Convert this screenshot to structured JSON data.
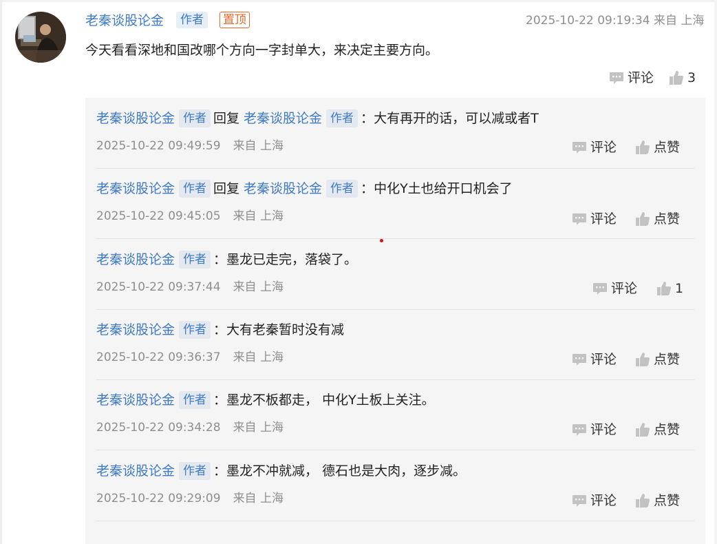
{
  "post": {
    "author": "老秦谈股论金",
    "author_badge": "作者",
    "pin_badge": "置顶",
    "timestamp": "2025-10-22 09:19:34",
    "location": "来自 上海",
    "content": "今天看看深地和国改哪个方向一字封单大，来决定主要方向。",
    "comment_label": "评论",
    "like_count": "3"
  },
  "icons": {
    "avatar": "user-avatar-photo",
    "comment": "speech-bubble-icon",
    "like": "thumbs-up-icon"
  },
  "colors": {
    "link_blue": "#3e7ac7",
    "badge_bg": "#e6eef8",
    "pin_orange": "#e06a2a",
    "meta_gray": "#8e8e8e",
    "reply_bg": "#f5f5f5",
    "icon_gray": "#c2c2c2"
  },
  "replies": [
    {
      "author": "老秦谈股论金",
      "badge": "作者",
      "reply_word": "回复",
      "reply_to": "老秦谈股论金",
      "reply_to_badge": "作者",
      "colon": "：",
      "text": "大有再开的话，可以减或者T",
      "time": "2025-10-22 09:49:59",
      "location": "来自 上海",
      "comment_label": "评论",
      "like_label": "点赞"
    },
    {
      "author": "老秦谈股论金",
      "badge": "作者",
      "reply_word": "回复",
      "reply_to": "老秦谈股论金",
      "reply_to_badge": "作者",
      "colon": "：",
      "text": "中化Y土也给开口机会了",
      "time": "2025-10-22 09:45:05",
      "location": "来自 上海",
      "comment_label": "评论",
      "like_label": "点赞"
    },
    {
      "author": "老秦谈股论金",
      "badge": "作者",
      "colon": "：",
      "text": "墨龙已走完，落袋了。",
      "time": "2025-10-22 09:37:44",
      "location": "来自 上海",
      "comment_label": "评论",
      "like_label": "1"
    },
    {
      "author": "老秦谈股论金",
      "badge": "作者",
      "colon": "：",
      "text": "大有老秦暂时没有减",
      "time": "2025-10-22 09:36:37",
      "location": "来自 上海",
      "comment_label": "评论",
      "like_label": "点赞"
    },
    {
      "author": "老秦谈股论金",
      "badge": "作者",
      "colon": "：",
      "text": "墨龙不板都走， 中化Y土板上关注。",
      "time": "2025-10-22 09:34:28",
      "location": "来自 上海",
      "comment_label": "评论",
      "like_label": "点赞"
    },
    {
      "author": "老秦谈股论金",
      "badge": "作者",
      "colon": "：",
      "text": "墨龙不冲就减， 德石也是大肉，逐步减。",
      "time": "2025-10-22 09:29:09",
      "location": "来自 上海",
      "comment_label": "评论",
      "like_label": "点赞"
    }
  ]
}
